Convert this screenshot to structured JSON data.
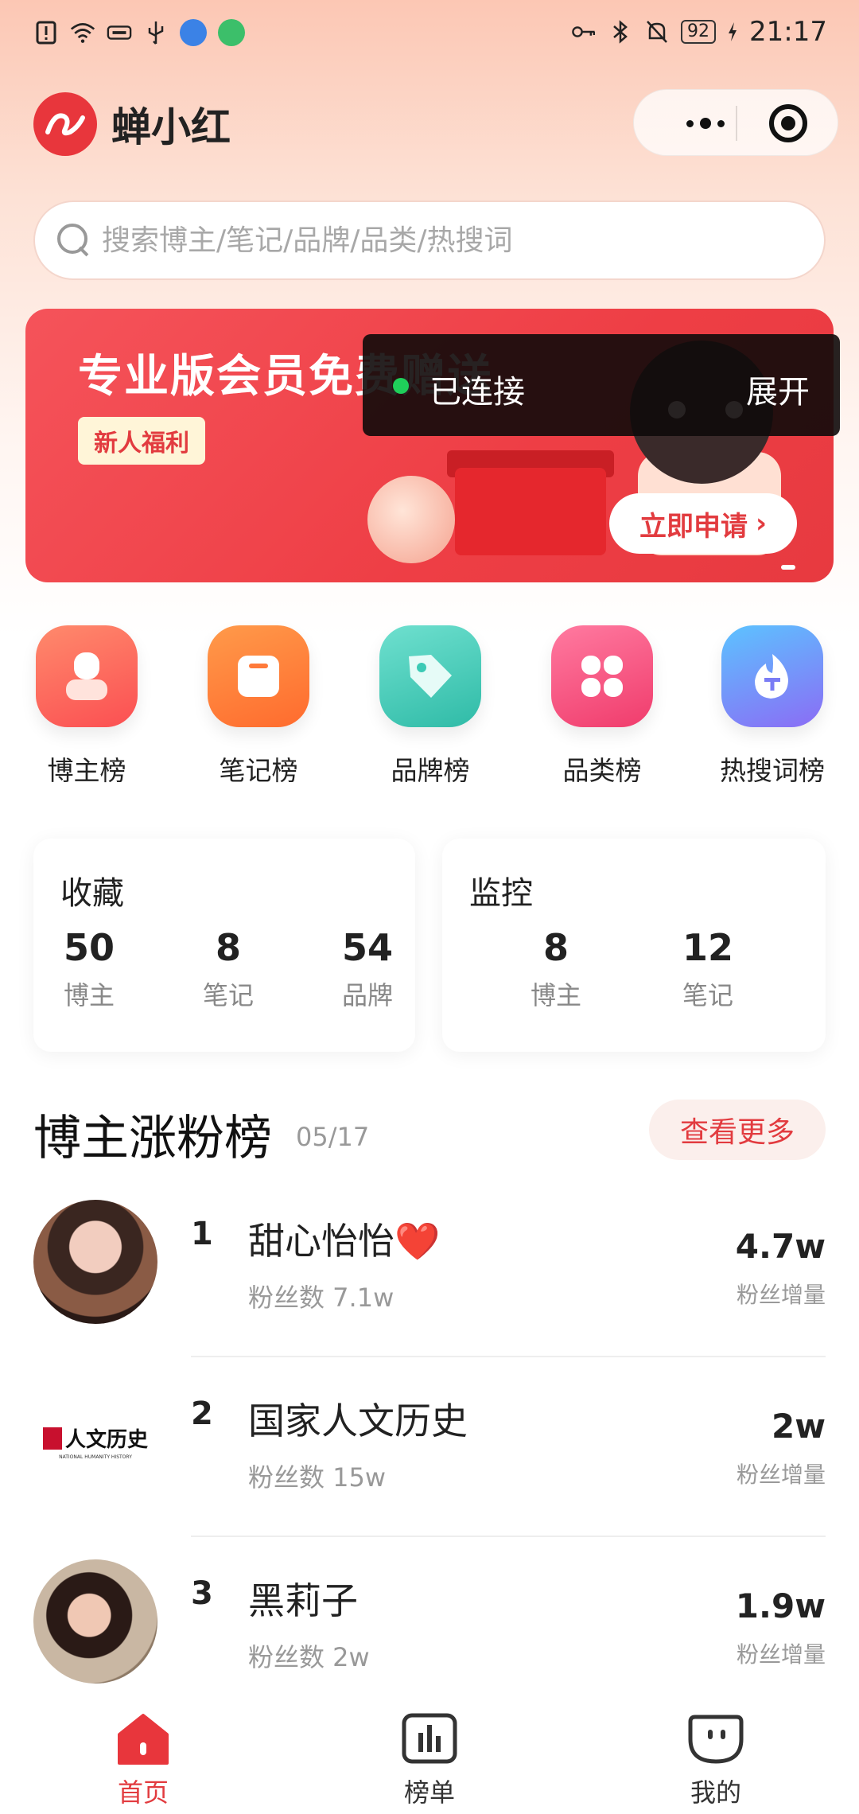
{
  "status_bar": {
    "time": "21:17",
    "battery": "92"
  },
  "header": {
    "app_name": "蝉小红"
  },
  "search": {
    "placeholder": "搜索博主/笔记/品牌/品类/热搜词"
  },
  "banner": {
    "title": "专业版会员免费赠送",
    "tag": "新人福利",
    "cta": "立即申请"
  },
  "toast": {
    "status": "已连接",
    "action": "展开"
  },
  "categories": [
    {
      "label": "博主榜",
      "icon": "person-icon",
      "color": "#fc5f5b"
    },
    {
      "label": "笔记榜",
      "icon": "note-icon",
      "color": "#ff7a3a"
    },
    {
      "label": "品牌榜",
      "icon": "tag-icon",
      "color": "#3ccab5"
    },
    {
      "label": "品类榜",
      "icon": "grid-icon",
      "color": "#f4517c"
    },
    {
      "label": "热搜词榜",
      "icon": "flame-icon",
      "color": "#7a7cf5"
    }
  ],
  "favorites": {
    "title": "收藏",
    "stats": [
      {
        "value": "50",
        "label": "博主"
      },
      {
        "value": "8",
        "label": "笔记"
      },
      {
        "value": "54",
        "label": "品牌"
      }
    ]
  },
  "monitor": {
    "title": "监控",
    "stats": [
      {
        "value": "8",
        "label": "博主"
      },
      {
        "value": "12",
        "label": "笔记"
      }
    ]
  },
  "ranking": {
    "title": "博主涨粉榜",
    "date": "05/17",
    "more": "查看更多",
    "items": [
      {
        "rank": "1",
        "name": "甜心怡怡❤️",
        "fans": "粉丝数 7.1w",
        "growth": "4.7w",
        "growth_label": "粉丝增量"
      },
      {
        "rank": "2",
        "name": "国家人文历史",
        "fans": "粉丝数 15w",
        "growth": "2w",
        "growth_label": "粉丝增量",
        "logo_text": "人文历史",
        "logo_sub": "NATIONAL HUMANITY HISTORY"
      },
      {
        "rank": "3",
        "name": "黑莉子",
        "fans": "粉丝数 2w",
        "growth": "1.9w",
        "growth_label": "粉丝增量"
      }
    ]
  },
  "bottom_nav": [
    {
      "label": "首页",
      "icon": "home-icon",
      "active": true
    },
    {
      "label": "榜单",
      "icon": "chart-icon",
      "active": false
    },
    {
      "label": "我的",
      "icon": "face-icon",
      "active": false
    }
  ],
  "colors": {
    "accent": "#e23b3f",
    "banner": "#ee3e45",
    "connected": "#1fcf5a"
  }
}
